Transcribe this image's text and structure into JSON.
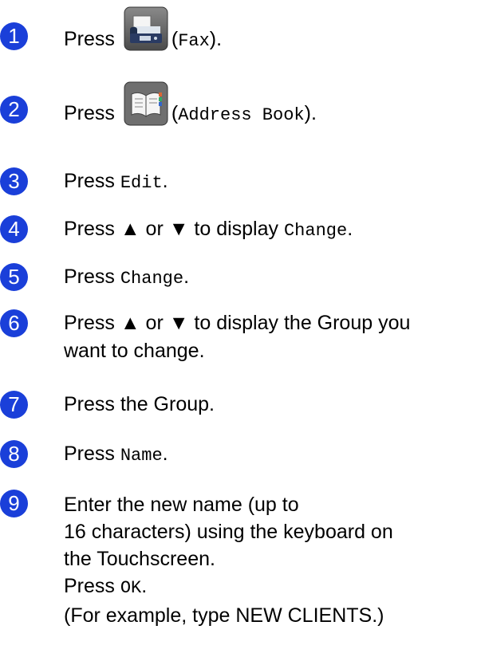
{
  "steps": [
    {
      "number": "1",
      "press": "Press",
      "paren_open": "(",
      "code": "Fax",
      "paren_close": ").",
      "icon": "fax-icon"
    },
    {
      "number": "2",
      "press": "Press",
      "paren_open": "(",
      "code": "Address Book",
      "paren_close": ").",
      "icon": "address-book-icon"
    },
    {
      "number": "3",
      "press": "Press",
      "code": "Edit",
      "end": "."
    },
    {
      "number": "4",
      "before": "Press ▲ or ▼ to display",
      "code": "Change",
      "end": "."
    },
    {
      "number": "5",
      "press": "Press",
      "code": "Change",
      "end": "."
    },
    {
      "number": "6",
      "line1": "Press ▲ or ▼ to display the Group you",
      "line2": "want to change."
    },
    {
      "number": "7",
      "text": "Press the Group."
    },
    {
      "number": "8",
      "press": "Press",
      "code": "Name",
      "end": "."
    },
    {
      "number": "9",
      "line1": "Enter the new name (up to",
      "line2": "16 characters) using the keyboard on",
      "line3": "the Touchscreen.",
      "line4_press": "Press",
      "line4_code": "OK",
      "line4_end": ".",
      "line5": "(For example, type NEW CLIENTS.)"
    }
  ]
}
